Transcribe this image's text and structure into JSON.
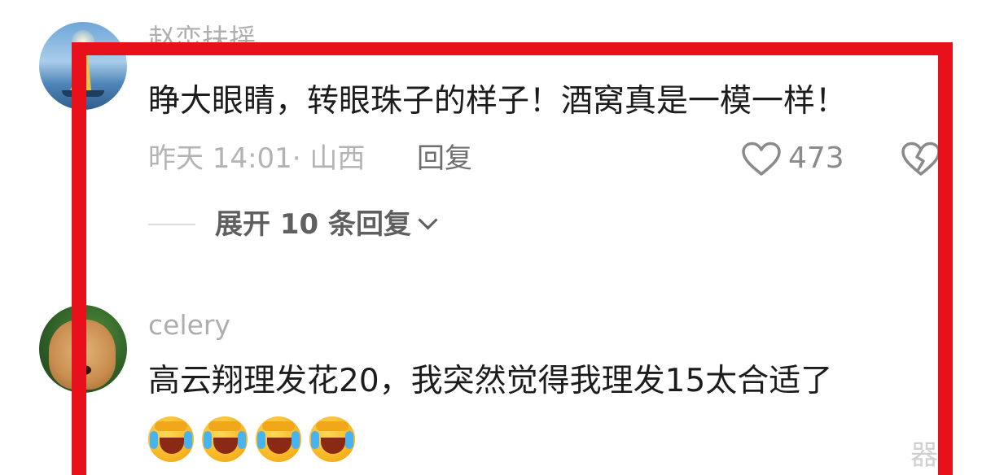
{
  "comments": [
    {
      "username": "赵峦扶摇",
      "text": "睁大眼睛，转眼珠子的样子！酒窝真是一模一样！",
      "meta": "昨天 14:01· 山西",
      "reply_label": "回复",
      "like_count": "473",
      "expand_label": "展开 10 条回复"
    },
    {
      "username": "celery",
      "text": "高云翔理发花20，我突然觉得我理发15太合适了",
      "emojis": [
        "grinning-squinting-tears-emoji",
        "grinning-squinting-tears-emoji",
        "grinning-squinting-tears-emoji",
        "grinning-squinting-tears-emoji"
      ]
    }
  ],
  "icons": {
    "like": "heart-outline-icon",
    "dislike": "broken-heart-icon",
    "expand": "chevron-down-icon"
  },
  "colors": {
    "highlight_border": "#e8101a",
    "primary_text": "#1c1c1c",
    "secondary_text": "#aeaeae"
  },
  "watermark": "器"
}
